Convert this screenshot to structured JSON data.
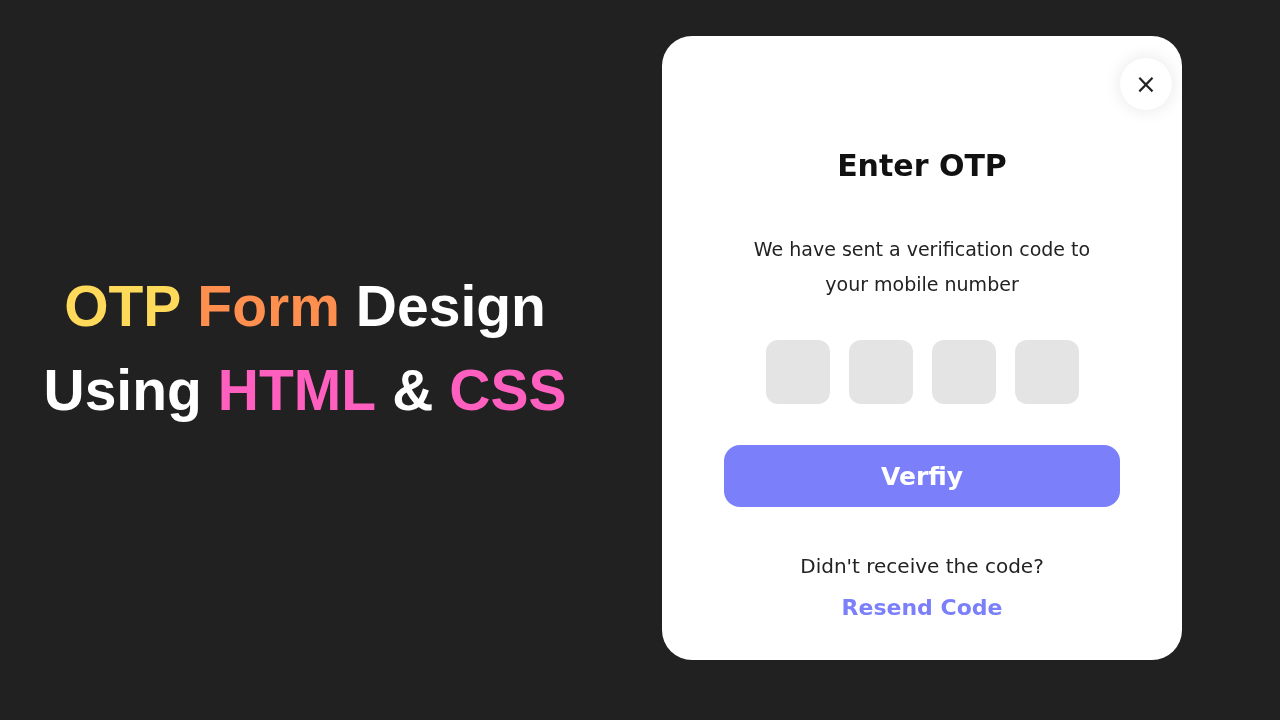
{
  "headline": {
    "lines": [
      [
        {
          "text": "OTP",
          "color": "#ffd95a"
        },
        {
          "text": "Form",
          "color": "#ff8f4f"
        },
        {
          "text": "Design",
          "color": "#ffffff"
        }
      ],
      [
        {
          "text": "Using",
          "color": "#ffffff"
        },
        {
          "text": "HTML",
          "color": "#ff5fbf"
        },
        {
          "text": "&",
          "color": "#ffffff"
        },
        {
          "text": "CSS",
          "color": "#ff5fbf"
        }
      ]
    ]
  },
  "dialog": {
    "close": "×",
    "title": "Enter OTP",
    "message": "We have sent a verification code to your mobile number",
    "otp_fields": [
      {
        "kind": "digit"
      },
      {
        "kind": "digit"
      },
      {
        "kind": "digit"
      },
      {
        "kind": "digit"
      }
    ],
    "button": "Verfiy",
    "prompt": "Didn't receive the code?",
    "link": "Resend Code"
  }
}
